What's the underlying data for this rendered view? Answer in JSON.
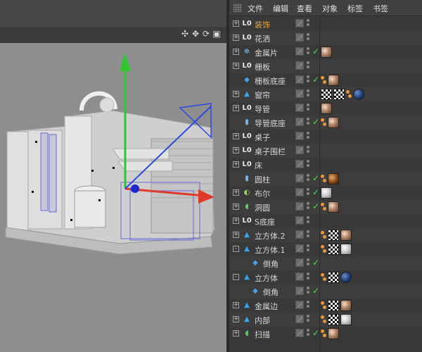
{
  "menu": [
    "文件",
    "编辑",
    "查看",
    "对象",
    "标签",
    "书签"
  ],
  "viewport": {
    "nav_icons": [
      "move-view-icon",
      "move-icon",
      "rotate-icon",
      "maximize-icon"
    ]
  },
  "objects": [
    {
      "name": "装饰",
      "icon": "null",
      "highlight": true,
      "expander": "+",
      "indent": 0,
      "check": false,
      "tags": []
    },
    {
      "name": "花洒",
      "icon": "null",
      "expander": "+",
      "indent": 0,
      "check": false,
      "tags": []
    },
    {
      "name": "金属片",
      "icon": "gear",
      "expander": "+",
      "indent": 0,
      "check": true,
      "tags": [
        "metal"
      ]
    },
    {
      "name": "栅板",
      "icon": "null",
      "expander": "+",
      "indent": 0,
      "check": false,
      "tags": []
    },
    {
      "name": "栅板底座",
      "icon": "cube",
      "expander": "",
      "indent": 0,
      "check": true,
      "tags": [
        "dotpair",
        "metal"
      ]
    },
    {
      "name": "窗帘",
      "icon": "poly",
      "expander": "+",
      "indent": 0,
      "check": false,
      "tags": [
        "checker",
        "checker",
        "dotpair",
        "blue"
      ]
    },
    {
      "name": "导管",
      "icon": "null",
      "expander": "+",
      "indent": 0,
      "check": false,
      "tags": [
        "metal"
      ]
    },
    {
      "name": "导管底座",
      "icon": "cylinder",
      "expander": "",
      "indent": 0,
      "check": true,
      "tags": [
        "dotpair",
        "metal"
      ]
    },
    {
      "name": "桌子",
      "icon": "null",
      "expander": "+",
      "indent": 0,
      "check": false,
      "tags": []
    },
    {
      "name": "桌子围栏",
      "icon": "null",
      "expander": "+",
      "indent": 0,
      "check": false,
      "tags": []
    },
    {
      "name": "床",
      "icon": "null",
      "expander": "+",
      "indent": 0,
      "check": false,
      "tags": []
    },
    {
      "name": "圆柱",
      "icon": "cylinder",
      "expander": "",
      "indent": 0,
      "check": true,
      "tags": [
        "dotpair",
        "brown"
      ]
    },
    {
      "name": "布尔",
      "icon": "boole",
      "expander": "+",
      "indent": 0,
      "check": true,
      "tags": [
        "white"
      ]
    },
    {
      "name": "洞圆",
      "icon": "sweep",
      "expander": "+",
      "indent": 0,
      "check": true,
      "tags": [
        "dotpair",
        "metal"
      ]
    },
    {
      "name": "S底座",
      "icon": "null",
      "expander": "+",
      "indent": 0,
      "check": false,
      "tags": []
    },
    {
      "name": "立方体.2",
      "icon": "poly",
      "expander": "+",
      "indent": 0,
      "check": false,
      "tags": [
        "dotpair",
        "checker",
        "metal"
      ]
    },
    {
      "name": "立方体.1",
      "icon": "poly",
      "expander": "-",
      "indent": 0,
      "check": false,
      "tags": [
        "dotpair",
        "checker",
        "white"
      ]
    },
    {
      "name": "倒角",
      "icon": "cube",
      "expander": "",
      "indent": 1,
      "check": true,
      "tags": []
    },
    {
      "name": "立方体",
      "icon": "poly",
      "expander": "-",
      "indent": 0,
      "check": false,
      "tags": [
        "dotpair",
        "checker",
        "blue"
      ]
    },
    {
      "name": "倒角",
      "icon": "cube",
      "expander": "",
      "indent": 1,
      "check": true,
      "tags": []
    },
    {
      "name": "金属边",
      "icon": "poly",
      "expander": "+",
      "indent": 0,
      "check": false,
      "tags": [
        "dotpair",
        "checker",
        "metal"
      ]
    },
    {
      "name": "内部",
      "icon": "poly",
      "expander": "+",
      "indent": 0,
      "check": false,
      "tags": [
        "dotpair",
        "checker",
        "white"
      ]
    },
    {
      "name": "扫描",
      "icon": "sweep",
      "expander": "+",
      "indent": 0,
      "check": true,
      "tags": [
        "dotpair",
        "metal"
      ]
    }
  ],
  "colors": {
    "highlight": "#e6a93a",
    "null_icon": "#e8e8e8",
    "check": "#5fd35f",
    "axis_x": "#e03a2a",
    "axis_y": "#2ec82e",
    "axis_z": "#2a4ae0"
  }
}
